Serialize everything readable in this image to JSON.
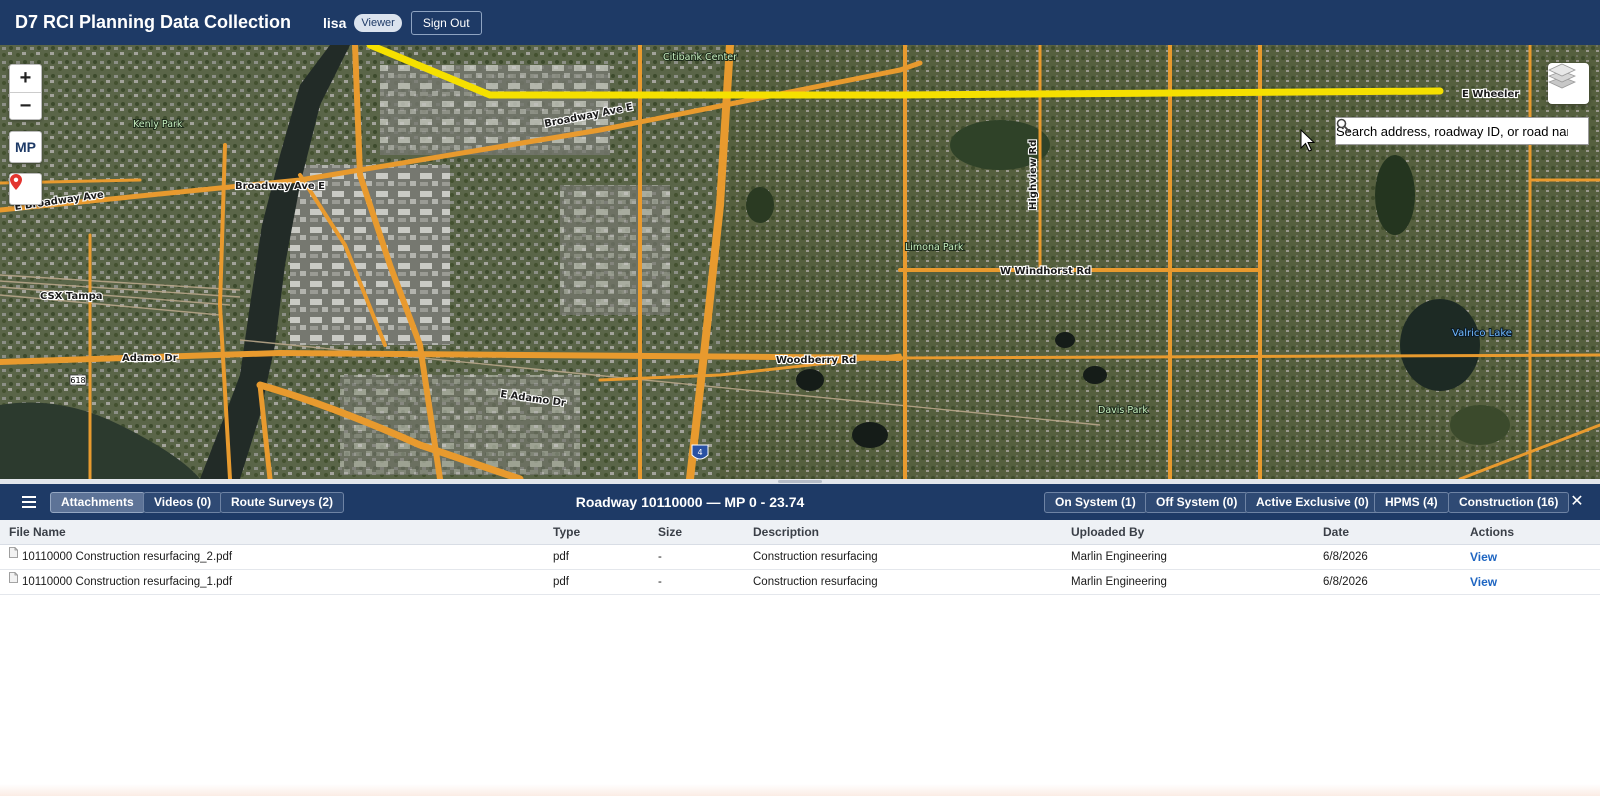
{
  "header": {
    "title": "D7 RCI Planning Data Collection",
    "user": "lisa",
    "role": "Viewer",
    "sign_out": "Sign Out"
  },
  "map": {
    "zoom_in": "+",
    "zoom_out": "−",
    "mp_label": "MP",
    "search_placeholder": "Search address, roadway ID, or road name...",
    "labels": {
      "broadway_ave_1": "Broadway Ave E",
      "broadway_ave_2": "Broadway Ave E",
      "broadway_ave_3": "E Broadway Ave",
      "adamo_dr_1": "Adamo Dr",
      "adamo_dr_2": "E Adamo Dr",
      "woodberry_rd": "Woodberry Rd",
      "windhorst_rd": "W Windhorst Rd",
      "highview_rd": "Highview Rd",
      "csx_tampa": "CSX Tampa",
      "kenly_park": "Kenly Park",
      "limona_park": "Limona Park",
      "davis_park": "Davis Park",
      "valrico_lake": "Valrico Lake",
      "citibank_center": "Citibank Center",
      "e_wheeler": "E Wheeler",
      "route_618": "618",
      "i4": "4"
    }
  },
  "panel": {
    "tabs": [
      {
        "label": "Attachments",
        "active": true
      },
      {
        "label": "Videos (0)",
        "active": false
      },
      {
        "label": "Route Surveys (2)",
        "active": false
      }
    ],
    "title": "Roadway 10110000 — MP 0 - 23.74",
    "filters": [
      {
        "label": "On System (1)"
      },
      {
        "label": "Off System (0)"
      },
      {
        "label": "Active Exclusive (0)"
      },
      {
        "label": "HPMS (4)"
      },
      {
        "label": "Construction (16)"
      }
    ],
    "close": "✕"
  },
  "table": {
    "columns": [
      "File Name",
      "Type",
      "Size",
      "Description",
      "Uploaded By",
      "Date",
      "Actions"
    ],
    "rows": [
      {
        "file": "10110000 Construction resurfacing_2.pdf",
        "type": "pdf",
        "size": "-",
        "description": "Construction resurfacing",
        "uploaded_by": "Marlin Engineering",
        "date": "6/8/2026",
        "action": "View"
      },
      {
        "file": "10110000 Construction resurfacing_1.pdf",
        "type": "pdf",
        "size": "-",
        "description": "Construction resurfacing",
        "uploaded_by": "Marlin Engineering",
        "date": "6/8/2026",
        "action": "View"
      }
    ]
  },
  "colors": {
    "header_bg": "#1e3a66",
    "road": "#f0a030",
    "highlight_route": "#f5e000",
    "link": "#1f66c2"
  }
}
